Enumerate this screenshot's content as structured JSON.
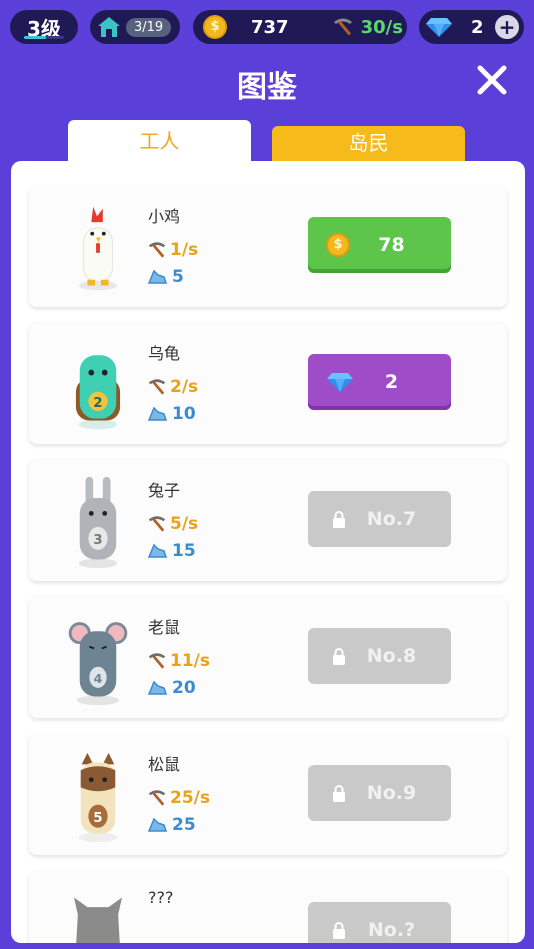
{
  "hud": {
    "level": "3级",
    "level_progress": 0.55,
    "houses": "3/19",
    "coins": "737",
    "rate": "30/s",
    "gems": "2",
    "plus": "+"
  },
  "title": "图鉴",
  "tabs": [
    "工人",
    "岛民"
  ],
  "icons": {
    "coin": "coin-icon",
    "gem": "gem-icon",
    "pickaxe": "pickaxe-icon",
    "sleep": "sleep-icon",
    "lock": "lock-icon",
    "house": "house-icon",
    "close": "close-icon"
  },
  "colors": {
    "background": "#5a3fd8",
    "rate_text": "#e9a21b",
    "sleep_text": "#3b8bd1",
    "buy_coin": "#5cc54a",
    "buy_gem": "#9e4cc7",
    "locked": "#c9c9c9"
  },
  "workers": [
    {
      "name": "小鸡",
      "rate": "1/s",
      "sleep": "5",
      "action": "78",
      "type": "coin"
    },
    {
      "name": "乌龟",
      "rate": "2/s",
      "sleep": "10",
      "action": "2",
      "type": "gem"
    },
    {
      "name": "兔子",
      "rate": "5/s",
      "sleep": "15",
      "action": "No.7",
      "type": "locked"
    },
    {
      "name": "老鼠",
      "rate": "11/s",
      "sleep": "20",
      "action": "No.8",
      "type": "locked"
    },
    {
      "name": "松鼠",
      "rate": "25/s",
      "sleep": "25",
      "action": "No.9",
      "type": "locked"
    },
    {
      "name": "???",
      "rate": "",
      "sleep": "???",
      "action": "No.?",
      "type": "locked"
    }
  ]
}
